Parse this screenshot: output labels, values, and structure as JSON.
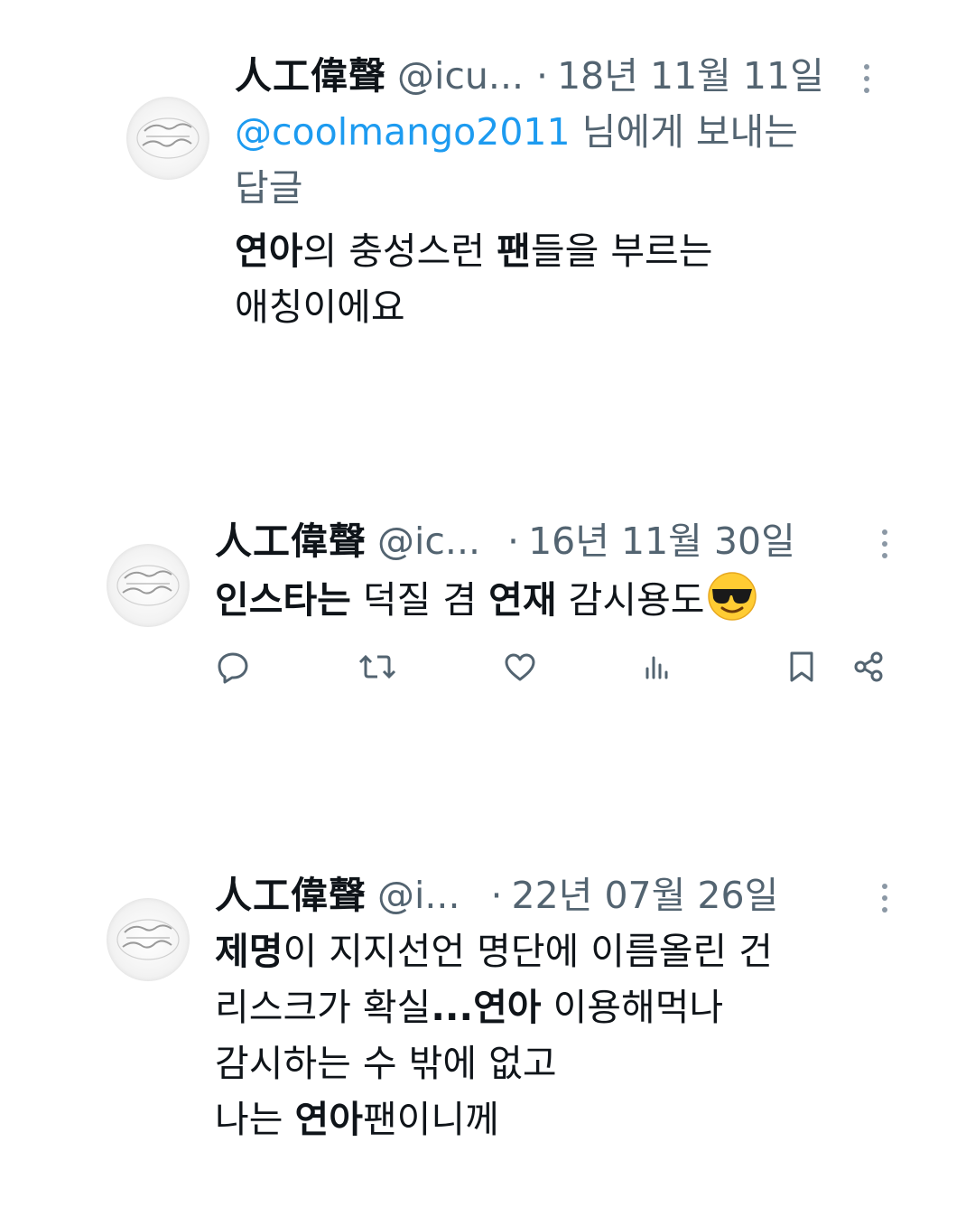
{
  "tweets": [
    {
      "author_name": "人工偉聲",
      "handle": "@icu...",
      "separator": "·",
      "date": "18년 11월 11일",
      "reply_mention": "@coolmango2011",
      "reply_suffix": " 님에게 보내는",
      "reply_line2": "답글",
      "text_lines": [
        [
          {
            "t": "연아",
            "b": true
          },
          {
            "t": "의 충성스런 ",
            "b": false
          },
          {
            "t": "팬",
            "b": true
          },
          {
            "t": "들을 부르는",
            "b": false
          }
        ],
        [
          {
            "t": "애칭이에요",
            "b": false
          }
        ]
      ]
    },
    {
      "author_name": "人工偉聲",
      "handle": "@ic...",
      "separator": "·",
      "date": "16년 11월 30일",
      "text_lines": [
        [
          {
            "t": "인스타는",
            "b": true
          },
          {
            "t": " 덕질 겸 ",
            "b": false
          },
          {
            "t": "연재",
            "b": true
          },
          {
            "t": " 감시용도",
            "b": false
          }
        ]
      ],
      "emoji": "smiling-face-with-sunglasses",
      "actions": [
        "reply-icon",
        "retweet-icon",
        "like-icon",
        "views-icon",
        "bookmark-icon",
        "share-icon"
      ]
    },
    {
      "author_name": "人工偉聲",
      "handle": "@i...",
      "separator": "·",
      "date": "22년 07월 26일",
      "text_lines": [
        [
          {
            "t": "제명",
            "b": true
          },
          {
            "t": "이 지지선언 명단에 이름올린 건",
            "b": false
          }
        ],
        [
          {
            "t": "리스크가 확실",
            "b": false
          },
          {
            "t": "...연아",
            "b": true
          },
          {
            "t": " 이용해먹나",
            "b": false
          }
        ],
        [
          {
            "t": "감시하는 수 밖에 없고",
            "b": false
          }
        ],
        [
          {
            "t": "나는 ",
            "b": false
          },
          {
            "t": "연아",
            "b": true
          },
          {
            "t": "팬이니께",
            "b": false
          }
        ]
      ]
    }
  ],
  "colors": {
    "text": "#0f1419",
    "muted": "#536471",
    "link": "#1d9bf0",
    "icon": "#536471"
  }
}
